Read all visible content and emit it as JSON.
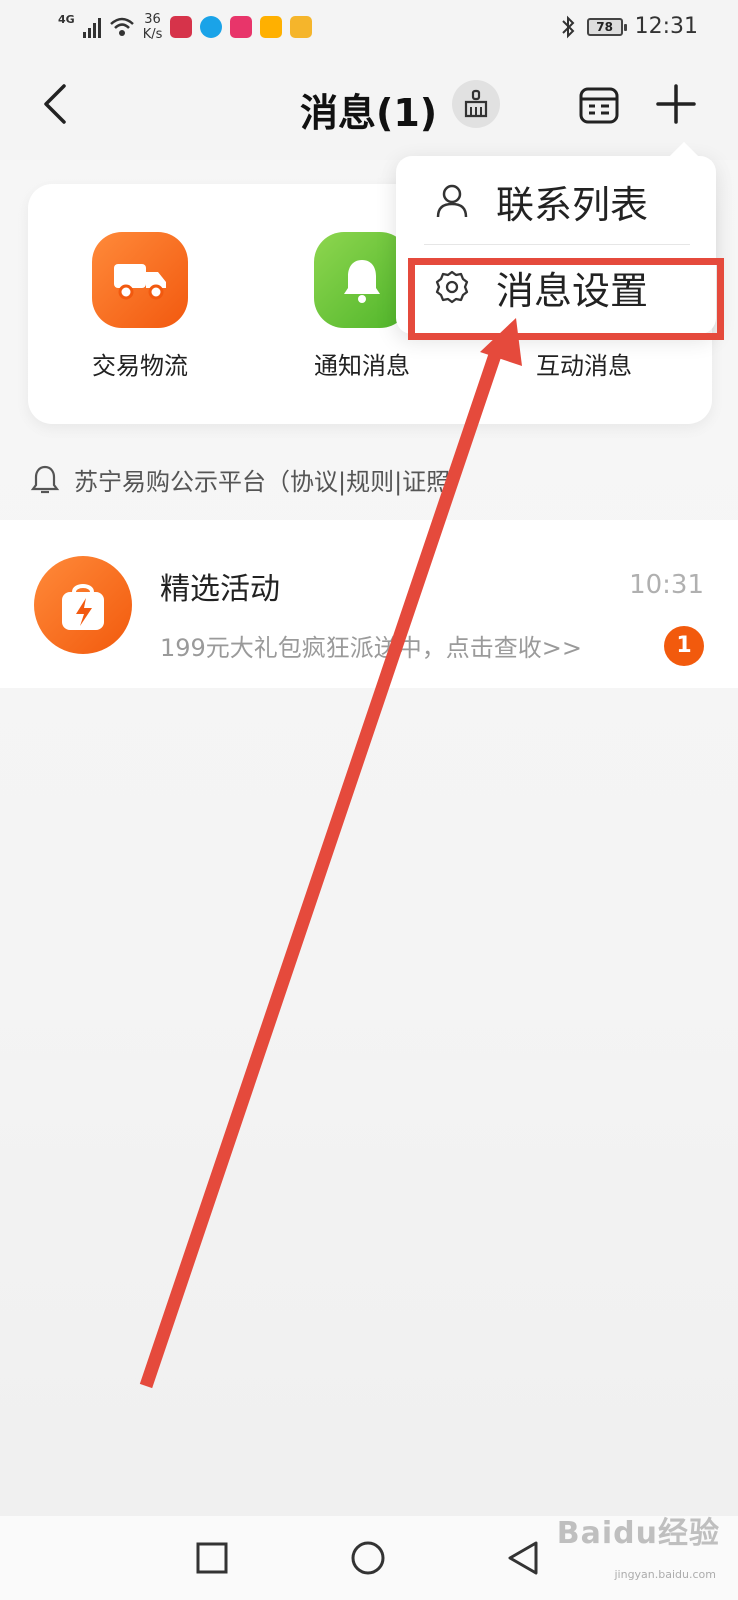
{
  "status_bar": {
    "network": "4G",
    "speed_value": "36",
    "speed_unit": "K/s",
    "battery": "78",
    "time": "12:31",
    "app_icon_colors": [
      "#d6334a",
      "#1aa3e8",
      "#e8356a",
      "#ffb000",
      "#f5b52b"
    ]
  },
  "header": {
    "title": "消息(1)",
    "back_icon": "chevron-left-icon",
    "clean_icon": "broom-icon",
    "calendar_icon": "calendar-icon",
    "add_icon": "plus-icon"
  },
  "categories": [
    {
      "label": "交易物流",
      "icon": "truck-icon",
      "color": "#f6691e"
    },
    {
      "label": "通知消息",
      "icon": "bell-icon",
      "color": "#6cc43a"
    },
    {
      "label": "互动消息",
      "icon": "chat-icon",
      "color": "#3b8cf0"
    }
  ],
  "notice": {
    "text": "苏宁易购公示平台（协议|规则|证照）"
  },
  "messages": [
    {
      "title": "精选活动",
      "time": "10:31",
      "preview": "199元大礼包疯狂派送中，点击查收>>",
      "badge": "1"
    }
  ],
  "dropdown": {
    "items": [
      {
        "label": "联系列表",
        "icon": "person-icon"
      },
      {
        "label": "消息设置",
        "icon": "gear-icon"
      }
    ]
  },
  "annotation": {
    "color": "#e54a3c"
  },
  "watermark": {
    "text": "Baidu经验",
    "sub": "jingyan.baidu.com"
  }
}
